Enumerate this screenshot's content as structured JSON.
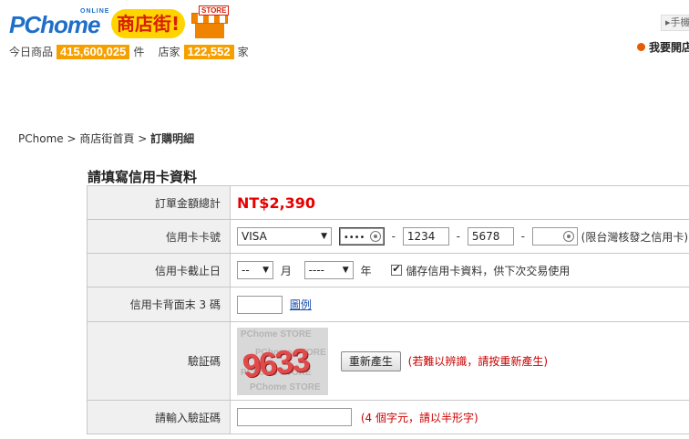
{
  "header": {
    "logo_brand": "PChome",
    "logo_online": "ONLINE",
    "logo_shop": "商店街!",
    "logo_store_tag": "STORE",
    "stats_products_label": "今日商品",
    "stats_products_value": "415,600,025",
    "stats_products_unit": "件",
    "stats_shops_label": "店家",
    "stats_shops_value": "122,552",
    "stats_shops_unit": "家",
    "top_right_button": "手機",
    "open_shop_link": "我要開店"
  },
  "breadcrumb": {
    "items": [
      "PChome",
      "商店街首頁"
    ],
    "separator": ">",
    "current": "訂購明細"
  },
  "form": {
    "title": "請填寫信用卡資料",
    "total_label": "訂單金額總計",
    "total_value": "NT$2,390",
    "card_label": "信用卡卡號",
    "card_type": "VISA",
    "card_part1": "••••",
    "card_part2": "1234",
    "card_part3": "5678",
    "card_part4": "",
    "card_dash": "-",
    "card_note": "(限台灣核發之信用卡)",
    "expiry_label": "信用卡截止日",
    "expiry_month": "--",
    "expiry_month_unit": "月",
    "expiry_year": "----",
    "expiry_year_unit": "年",
    "save_card_label": "儲存信用卡資料，供下次交易使用",
    "cvv_label": "信用卡背面末 3 碼",
    "cvv_value": "",
    "cvv_example_link": "圖例",
    "captcha_label": "驗証碼",
    "captcha_code": "9633",
    "captcha_bg_text": "PChome STORE",
    "regen_button": "重新產生",
    "regen_note": "(若難以辨識，請按重新產生)",
    "captcha_input_label": "請輸入驗証碼",
    "captcha_input_value": "",
    "captcha_input_note": "(4 個字元，請以半形字)"
  },
  "colors": {
    "accent_red": "#e60000",
    "stat_orange": "#f6a000",
    "link_blue": "#1a4fb0"
  }
}
